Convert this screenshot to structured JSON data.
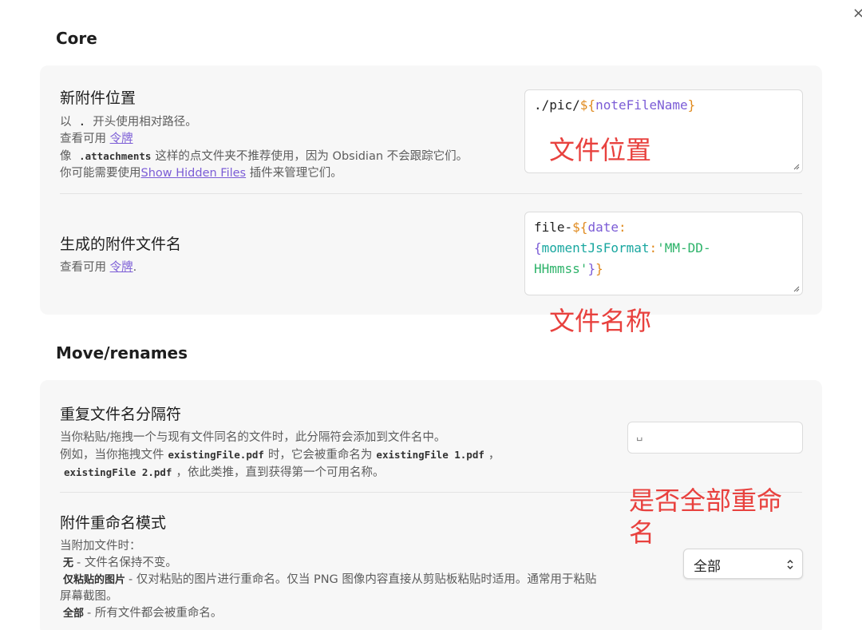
{
  "window": {
    "close_glyph": "×"
  },
  "sections": {
    "core_title": "Core",
    "move_title": "Move/renames"
  },
  "core": {
    "attachment_location": {
      "name": "新附件位置",
      "desc_line1_prefix": "以",
      "desc_line1_code": ".",
      "desc_line1_suffix": "开头使用相对路径。",
      "desc_line2_prefix": "查看可用",
      "desc_line2_link": "令牌",
      "desc_line3_prefix": "像",
      "desc_line3_code": ".attachments",
      "desc_line3_suffix": "这样的点文件夹不推荐使用，因为 Obsidian 不会跟踪它们。",
      "desc_line4_prefix": "你可能需要使用",
      "desc_line4_link": "Show Hidden Files",
      "desc_line4_suffix": "插件来管理它们。",
      "value_path": "./pic/",
      "value_dollar": "${",
      "value_var": "noteFileName",
      "value_close": "}"
    },
    "generated_filename": {
      "name": "生成的附件文件名",
      "desc_prefix": "查看可用",
      "desc_link": "令牌",
      "desc_suffix": ".",
      "value_prefix": "file-",
      "value_dollar": "${",
      "value_var": "date",
      "value_colon": ":",
      "value_brace_open": "{",
      "value_key": "momentJsFormat",
      "value_colon2": ":",
      "value_str_a": "'MM-DD-",
      "value_str_b": "HHmmss'",
      "value_close_inner": "}",
      "value_close_outer": "}"
    }
  },
  "move": {
    "duplicate_separator": {
      "name": "重复文件名分隔符",
      "desc_line1": "当你粘贴/拖拽一个与现有文件同名的文件时，此分隔符会添加到文件名中。",
      "desc_line2_prefix": "例如，当你拖拽文件",
      "desc_line2_code1": "existingFile.pdf",
      "desc_line2_mid": "时，它会被重命名为",
      "desc_line2_code2": "existingFile 1.pdf",
      "desc_line2_comma": "，",
      "desc_line3_code": "existingFile 2.pdf",
      "desc_line3_suffix": "，依此类推，直到获得第一个可用名称。",
      "value": "␣"
    },
    "rename_mode": {
      "name": "附件重命名模式",
      "desc_intro": "当附加文件时：",
      "opt_none_label": "无",
      "opt_none_desc": "- 文件名保持不变。",
      "opt_pasted_label": "仅粘贴的图片",
      "opt_pasted_desc": "- 仅对粘贴的图片进行重命名。仅当 PNG 图像内容直接从剪贴板粘贴时适用。通常用于粘贴",
      "opt_pasted_desc2": "屏幕截图。",
      "opt_all_label": "全部",
      "opt_all_desc": "- 所有文件都会被重命名。",
      "selected": "全部"
    }
  },
  "annotations": {
    "file_location": "文件位置",
    "file_name": "文件名称",
    "rename_all_line1": "是否全部重命",
    "rename_all_line2": "名"
  },
  "colors": {
    "accent_link": "#7b5cd6",
    "annotation_red": "#e8413e",
    "card_bg": "#f7f7f7"
  }
}
